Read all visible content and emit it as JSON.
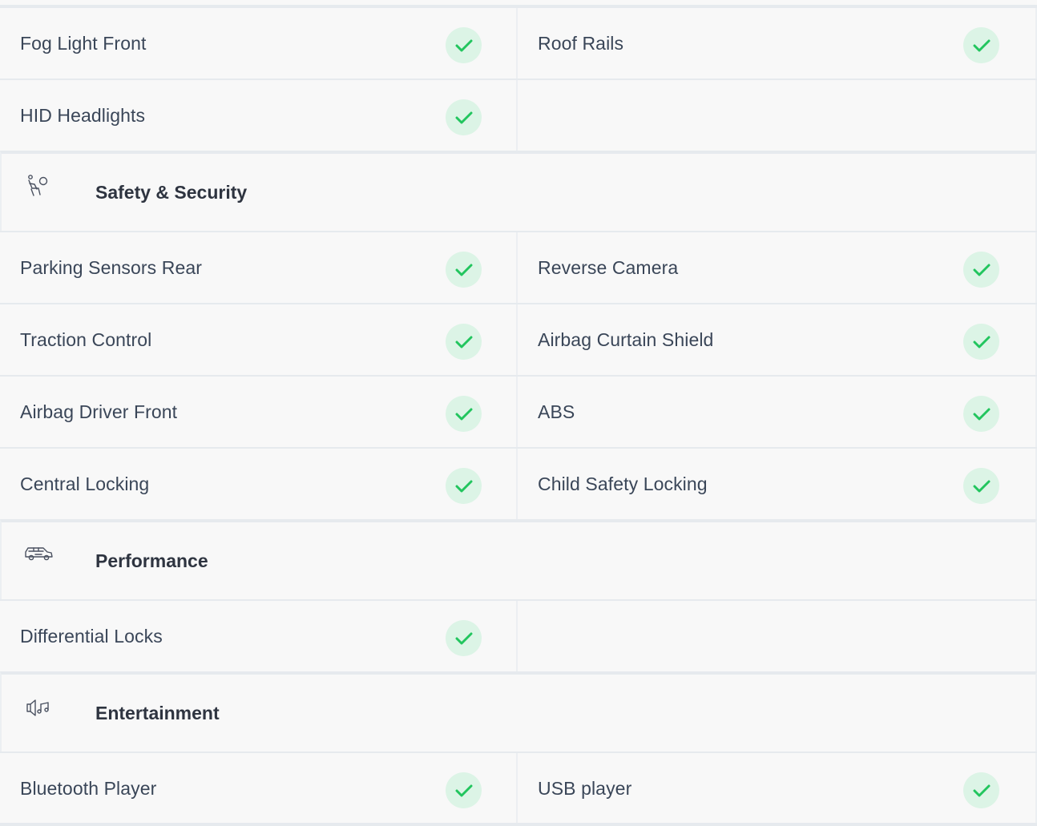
{
  "colors": {
    "check_bg": "#dcf4e6",
    "check_mark": "#22c55e",
    "text": "#3a4658",
    "heading": "#2e3440"
  },
  "rows": [
    {
      "left": {
        "label": "Fog Light Front",
        "checked": true
      },
      "right": {
        "label": "Roof Rails",
        "checked": true
      }
    },
    {
      "left": {
        "label": "HID Headlights",
        "checked": true
      },
      "right": null
    }
  ],
  "sections": [
    {
      "title": "Safety & Security",
      "icon": "airbag-seat-icon",
      "rows": [
        {
          "left": {
            "label": "Parking Sensors Rear",
            "checked": true
          },
          "right": {
            "label": "Reverse Camera",
            "checked": true
          }
        },
        {
          "left": {
            "label": "Traction Control",
            "checked": true
          },
          "right": {
            "label": "Airbag Curtain Shield",
            "checked": true
          }
        },
        {
          "left": {
            "label": "Airbag Driver Front",
            "checked": true
          },
          "right": {
            "label": "ABS",
            "checked": true
          }
        },
        {
          "left": {
            "label": "Central Locking",
            "checked": true
          },
          "right": {
            "label": "Child Safety Locking",
            "checked": true
          }
        }
      ]
    },
    {
      "title": "Performance",
      "icon": "car-icon",
      "rows": [
        {
          "left": {
            "label": "Differential Locks",
            "checked": true
          },
          "right": null
        }
      ]
    },
    {
      "title": "Entertainment",
      "icon": "speaker-music-icon",
      "rows": [
        {
          "left": {
            "label": "Bluetooth Player",
            "checked": true
          },
          "right": {
            "label": "USB player",
            "checked": true
          }
        }
      ]
    }
  ]
}
